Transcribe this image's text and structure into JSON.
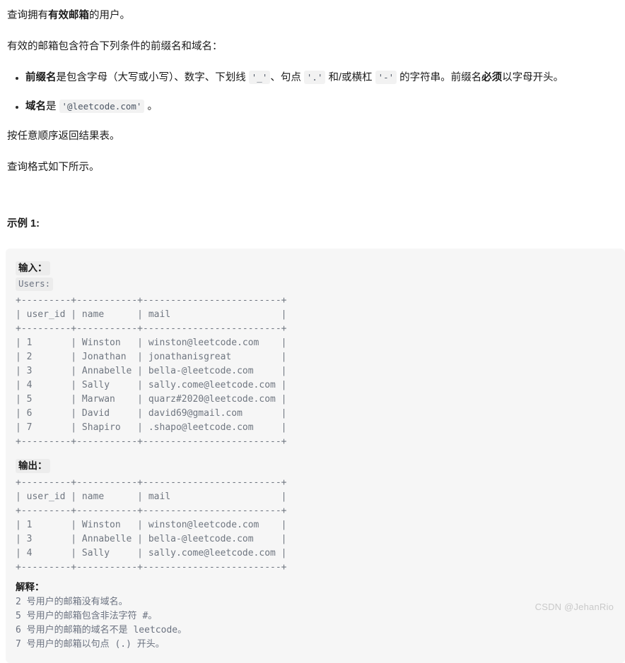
{
  "intro": {
    "line1_pre": "查询拥有",
    "line1_bold": "有效邮箱",
    "line1_post": "的用户。",
    "line2": "有效的邮箱包含符合下列条件的前缀名和域名：",
    "line3": "按任意顺序返回结果表。",
    "line4": "查询格式如下所示。"
  },
  "rules": {
    "rule1": {
      "bold_lead": "前缀名",
      "text1": "是包含字母（大写或小写）、数字、下划线 ",
      "code1": "'_'",
      "text2": "、句点 ",
      "code2": "'.'",
      "text3": " 和/或横杠 ",
      "code3": "'-'",
      "text4": " 的字符串。前缀名",
      "bold_must": "必须",
      "text5": "以字母开头。"
    },
    "rule2": {
      "bold_lead": "域名",
      "text1": "是 ",
      "code1": "'@leetcode.com'",
      "text2": " 。"
    }
  },
  "example": {
    "title": "示例 1:",
    "input_label": "输入：",
    "input_table_name": "Users:",
    "output_label": "输出：",
    "explain_label": "解释："
  },
  "input_table": {
    "border": "+---------+-----------+----------------------+",
    "columns": [
      "user_id",
      "name",
      "mail"
    ],
    "header_row": "| user_id | name      | mail                 |",
    "rows": [
      {
        "user_id": "1",
        "name": "Winston",
        "mail": "winston@leetcode.com",
        "line": "| 1       | Winston   | winston@leetcode.com |"
      },
      {
        "user_id": "2",
        "name": "Jonathan",
        "mail": "jonathanisgreat",
        "line": "| 2       | Jonathan  | jonathanisgreat      |"
      },
      {
        "user_id": "3",
        "name": "Annabelle",
        "mail": "bella-@leetcode.com",
        "line": "| 3       | Annabelle | bella-@leetcode.com  |"
      },
      {
        "user_id": "4",
        "name": "Sally",
        "mail": "sally.come@leetcode.com",
        "line": "| 4       | Sally     | sally.come@leetcode.com |"
      },
      {
        "user_id": "5",
        "name": "Marwan",
        "mail": "quarz#2020@leetcode.com",
        "line": "| 5       | Marwan    | quarz#2020@leetcode.com |"
      },
      {
        "user_id": "6",
        "name": "David",
        "mail": "david69@gmail.com",
        "line": "| 6       | David     | david69@gmail.com    |"
      },
      {
        "user_id": "7",
        "name": "Shapiro",
        "mail": ".shapo@leetcode.com",
        "line": "| 7       | Shapiro   | .shapo@leetcode.com  |"
      }
    ],
    "ascii": "+---------+-----------+-------------------------+\n| user_id | name      | mail                    |\n+---------+-----------+-------------------------+\n| 1       | Winston   | winston@leetcode.com    |\n| 2       | Jonathan  | jonathanisgreat         |\n| 3       | Annabelle | bella-@leetcode.com     |\n| 4       | Sally     | sally.come@leetcode.com |\n| 5       | Marwan    | quarz#2020@leetcode.com |\n| 6       | David     | david69@gmail.com       |\n| 7       | Shapiro   | .shapo@leetcode.com     |\n+---------+-----------+-------------------------+"
  },
  "output_table": {
    "columns": [
      "user_id",
      "name",
      "mail"
    ],
    "rows": [
      {
        "user_id": "1",
        "name": "Winston",
        "mail": "winston@leetcode.com"
      },
      {
        "user_id": "3",
        "name": "Annabelle",
        "mail": "bella-@leetcode.com"
      },
      {
        "user_id": "4",
        "name": "Sally",
        "mail": "sally.come@leetcode.com"
      }
    ],
    "ascii": "+---------+-----------+-------------------------+\n| user_id | name      | mail                    |\n+---------+-----------+-------------------------+\n| 1       | Winston   | winston@leetcode.com    |\n| 3       | Annabelle | bella-@leetcode.com     |\n| 4       | Sally     | sally.come@leetcode.com |\n+---------+-----------+-------------------------+"
  },
  "explanation": {
    "lines": [
      "2 号用户的邮箱没有域名。",
      "5 号用户的邮箱包含非法字符 #。",
      "6 号用户的邮箱的域名不是 leetcode。",
      "7 号用户的邮箱以句点 (.) 开头。"
    ],
    "line1": "2 号用户的邮箱没有域名。",
    "line2": "5 号用户的邮箱包含非法字符 #。",
    "line3": "6 号用户的邮箱的域名不是 leetcode。",
    "line4": "7 号用户的邮箱以句点 (.) 开头。"
  },
  "watermark": {
    "text": "CSDN @JehanRio"
  },
  "colors": {
    "page_bg": "#ffffff",
    "code_bg": "#f6f6f6",
    "chip_bg": "#ececec",
    "text": "#1a1a1a",
    "mono_text": "#6f7680",
    "cell_text": "#3f434a",
    "separator": "#8aa0b8",
    "watermark": "#c9c9c9"
  }
}
